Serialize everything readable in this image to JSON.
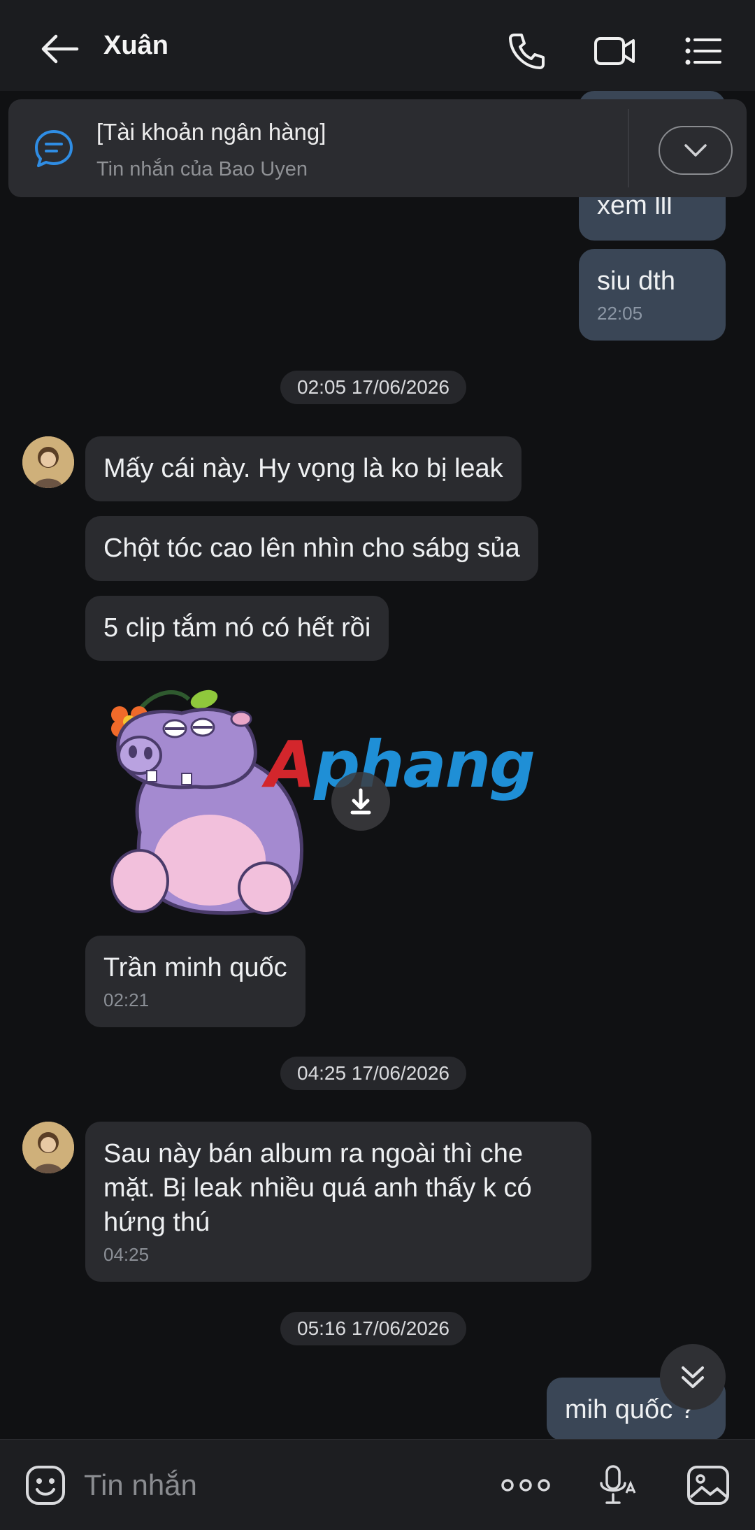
{
  "header": {
    "title": "Xuân",
    "icons": [
      "back-arrow-icon",
      "phone-icon",
      "video-icon",
      "menu-list-icon"
    ]
  },
  "pinned": {
    "title": "[Tài khoản ngân hàng]",
    "subtitle": "Tin nhắn của Bao Uyen"
  },
  "messages": {
    "out1_text": "xem lll",
    "out2_text": "siu dth",
    "out2_time": "22:05",
    "date1": "02:05 17/06/2026",
    "in1_text": "Mấy cái này. Hy vọng là ko bị leak",
    "in2_text": "Chột tóc cao lên nhìn cho sábg sủa",
    "in3_text": "5 clip tắm nó có hết rồi",
    "watermark_a": "A",
    "watermark_rest": "phang",
    "in4_text": "Trần minh quốc",
    "in4_time": "02:21",
    "date2": "04:25 17/06/2026",
    "in5_text": "Sau này bán album ra ngoài thì che mặt. Bị leak nhiều quá anh thấy k có hứng thú",
    "in5_time": "04:25",
    "date3": "05:16 17/06/2026",
    "out3_text": "mih quốc ?"
  },
  "composer": {
    "placeholder": "Tin nhắn"
  },
  "colors": {
    "background": "#101113",
    "outgoing_bubble": "#3a4656",
    "incoming_bubble": "#2a2b2f",
    "accent_blue": "#2f8de4"
  }
}
